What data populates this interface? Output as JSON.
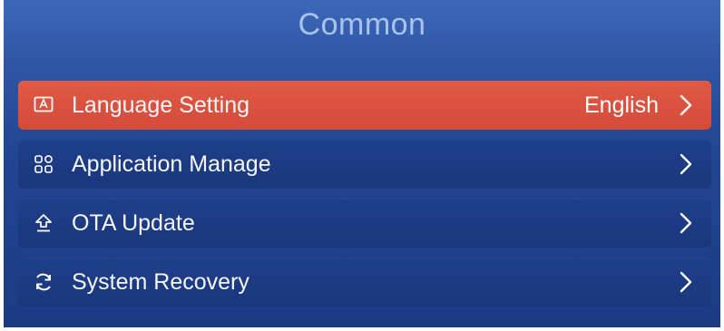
{
  "page": {
    "title": "Common"
  },
  "menu": {
    "items": [
      {
        "label": "Language Setting",
        "value": "English",
        "icon": "language-icon",
        "selected": true
      },
      {
        "label": "Application Manage",
        "value": "",
        "icon": "apps-grid-icon",
        "selected": false
      },
      {
        "label": "OTA Update",
        "value": "",
        "icon": "upload-arrow-icon",
        "selected": false
      },
      {
        "label": "System Recovery",
        "value": "",
        "icon": "refresh-icon",
        "selected": false
      }
    ]
  },
  "colors": {
    "background_top": "#3d68b8",
    "background_bottom": "#1b3a82",
    "row": "#1f3f8a",
    "row_selected": "#d44b3a",
    "title_text": "#a9c3ea",
    "text": "#f4f6fb"
  }
}
